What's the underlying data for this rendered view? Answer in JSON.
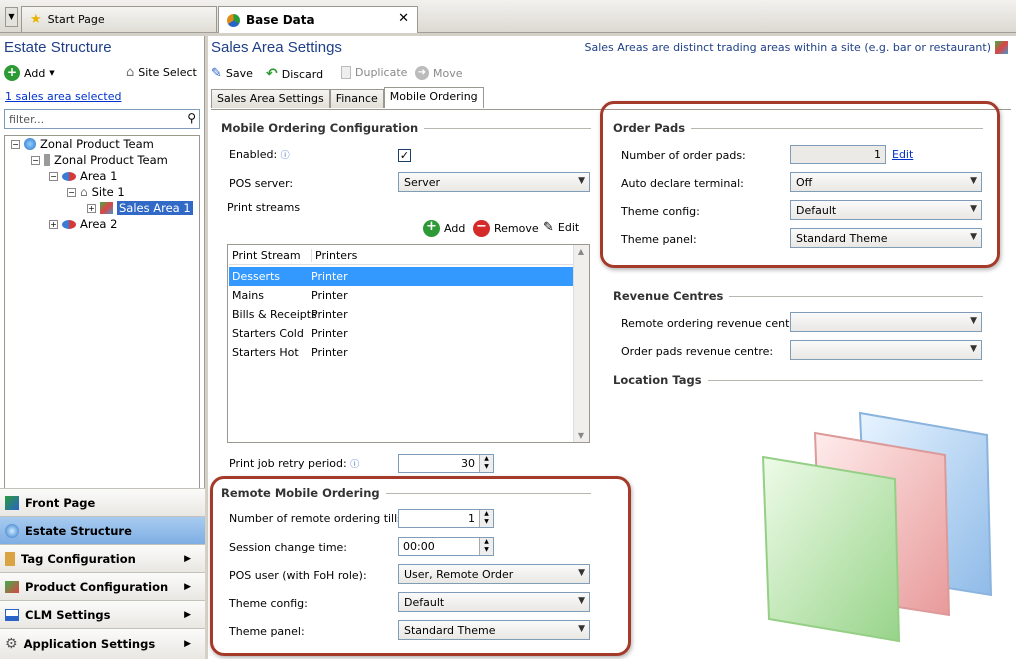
{
  "tabs": {
    "start_page": "Start Page",
    "base_data": "Base Data"
  },
  "left": {
    "title": "Estate Structure",
    "add": "Add",
    "site_select": "Site Select",
    "selected_link": "1 sales area selected",
    "filter_placeholder": "filter...",
    "tree": [
      "Zonal Product Team",
      "Zonal Product Team",
      "Area 1",
      "Site 1",
      "Sales Area 1",
      "Area 2"
    ],
    "nav": [
      "Front Page",
      "Estate Structure",
      "Tag Configuration",
      "Product Configuration",
      "CLM Settings",
      "Application Settings"
    ]
  },
  "main": {
    "title": "Sales Area Settings",
    "hint": "Sales Areas are distinct trading areas within a site (e.g. bar or restaurant)",
    "toolbar": {
      "save": "Save",
      "discard": "Discard",
      "duplicate": "Duplicate",
      "move": "Move"
    },
    "subtabs": [
      "Sales Area Settings",
      "Finance",
      "Mobile Ordering"
    ],
    "mobile": {
      "section": "Mobile Ordering Configuration",
      "enabled_label": "Enabled:",
      "pos_server_label": "POS server:",
      "pos_server": "Server",
      "print_streams": "Print streams",
      "add": "Add",
      "remove": "Remove",
      "edit": "Edit",
      "grid_headers": [
        "Print Stream",
        "Printers"
      ],
      "grid_rows": [
        [
          "Desserts",
          "Printer"
        ],
        [
          "Mains",
          "Printer"
        ],
        [
          "Bills & Receipts",
          "Printer"
        ],
        [
          "Starters Cold",
          "Printer"
        ],
        [
          "Starters Hot",
          "Printer"
        ]
      ],
      "retry_label": "Print job retry period:",
      "retry_value": "30"
    },
    "remote": {
      "section": "Remote Mobile Ordering",
      "tills_label": "Number of remote ordering tills:",
      "tills_value": "1",
      "session_label": "Session change time:",
      "session_value": "00:00",
      "pos_user_label": "POS user (with FoH role):",
      "pos_user_value": "User, Remote Order",
      "theme_config_label": "Theme config:",
      "theme_config_value": "Default",
      "theme_panel_label": "Theme panel:",
      "theme_panel_value": "Standard Theme"
    },
    "order_pads": {
      "section": "Order Pads",
      "count_label": "Number of order pads:",
      "count_value": "1",
      "edit": "Edit",
      "auto_declare_label": "Auto declare terminal:",
      "auto_declare_value": "Off",
      "theme_config_label": "Theme config:",
      "theme_config_value": "Default",
      "theme_panel_label": "Theme panel:",
      "theme_panel_value": "Standard Theme"
    },
    "revenue": {
      "section": "Revenue Centres",
      "remote_label": "Remote ordering revenue centre:",
      "pads_label": "Order pads revenue centre:"
    },
    "location_tags": "Location Tags"
  },
  "colors": {
    "accent": "#1e3f86",
    "highlight_box": "#a43a2a",
    "selection": "#3399ff"
  }
}
